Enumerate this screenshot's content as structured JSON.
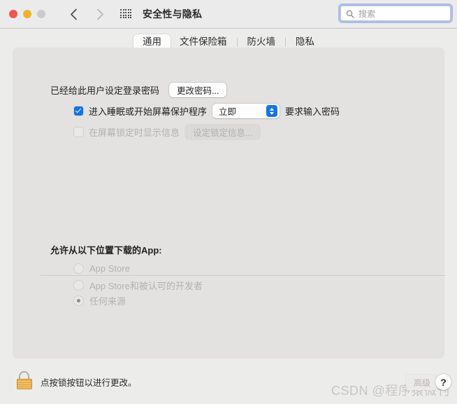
{
  "window": {
    "title": "安全性与隐私",
    "traffic_lights": [
      {
        "name": "close",
        "color": "#f0564c"
      },
      {
        "name": "minimize",
        "color": "#f2b12c"
      },
      {
        "name": "zoom",
        "color": "#cbcbcb"
      }
    ],
    "nav": {
      "back_icon": "chevron-left-icon",
      "forward_icon": "chevron-right-icon",
      "grid_icon": "show-all-grid-icon"
    },
    "search": {
      "icon": "search-icon",
      "placeholder": "搜索",
      "value": "",
      "focused": true,
      "focus_ring_color": "#a8bdf0"
    }
  },
  "tabs": [
    {
      "label": "通用",
      "selected": true
    },
    {
      "label": "文件保险箱",
      "selected": false
    },
    {
      "label": "防火墙",
      "selected": false
    },
    {
      "label": "隐私",
      "selected": false
    }
  ],
  "general": {
    "login_password_label": "已经给此用户设定登录密码",
    "change_password_button": "更改密码...",
    "require_password": {
      "checked": true,
      "prefix_label": "进入睡眠或开始屏幕保护程序",
      "delay_value": "立即",
      "suffix_label": "要求输入密码",
      "accent_color": "#1473e6"
    },
    "lock_message": {
      "checked": false,
      "enabled": false,
      "label": "在屏幕锁定时显示信息",
      "button": "设定锁定信息..."
    }
  },
  "download_sources": {
    "heading": "允许从以下位置下载的App:",
    "enabled": false,
    "options": [
      {
        "label": "App Store",
        "selected": false
      },
      {
        "label": "App Store和被认可的开发者",
        "selected": false
      },
      {
        "label": "任何来源",
        "selected": true
      }
    ]
  },
  "footer": {
    "lock_icon": "unlocked-padlock-icon",
    "note": "点按锁按钮以进行更改。",
    "advanced_button": "高级",
    "help_button": "?",
    "watermark": "CSDN @程序猿微刊"
  }
}
